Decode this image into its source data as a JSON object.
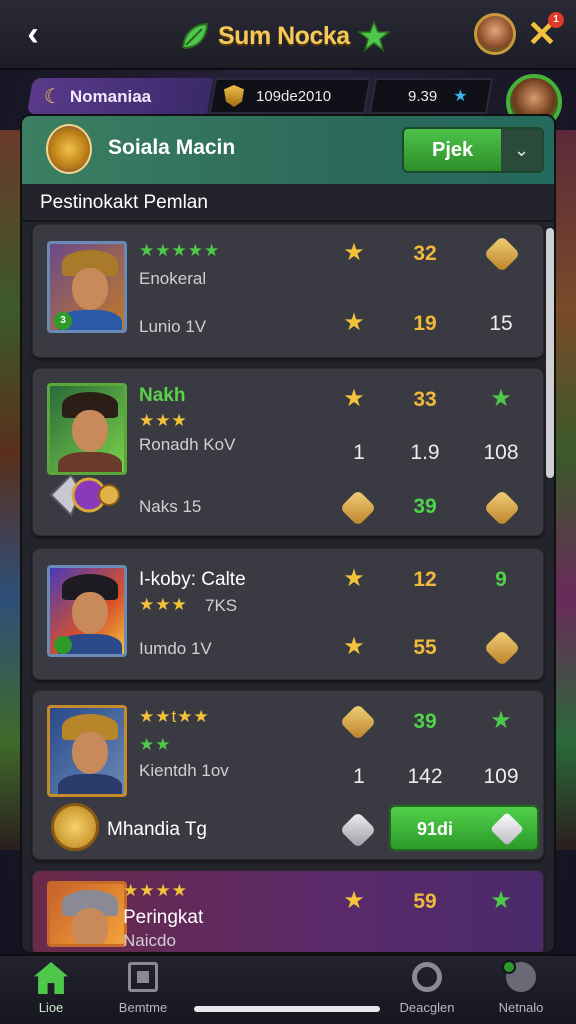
{
  "header": {
    "title": "Sum Nocka",
    "back_icon": "chevron-left-icon",
    "close_icon": "close-icon",
    "notification_count": "1"
  },
  "resources": {
    "player_name": "Nomaniaa",
    "code": "109de2010",
    "gems": "9.39"
  },
  "panel": {
    "title": "Soiala Macin",
    "dropdown_label": "Pjek",
    "section_label": "Pestinokakt Pemlan"
  },
  "cards": [
    {
      "stars": "★★★★★",
      "name": "Enokeral",
      "subtitle": "Lunio 1V",
      "portrait_level": "3",
      "stat_top": "32",
      "stat_bottom_a": "19",
      "stat_bottom_b": "15"
    },
    {
      "name": "Nakh",
      "stars": "★★★",
      "subtitle": "Ronadh KoV",
      "stat_top": "33",
      "row2_a": "1",
      "row2_b": "1.9",
      "row2_c": "108",
      "item_label": "Naks 15",
      "stat_bottom": "39"
    },
    {
      "name": "I-koby: Calte",
      "stars": "★★★",
      "stars_suffix": "7KS",
      "subtitle": "Iumdo 1V",
      "stat_top_a": "12",
      "stat_top_b": "9",
      "stat_bottom": "55"
    },
    {
      "stars": "★★t★★",
      "stars2": "★★",
      "subtitle": "Kientdh 1ov",
      "stat_top": "39",
      "row2_a": "1",
      "row2_b": "142",
      "row2_c": "109",
      "reward_label": "Mhandia Tg",
      "claim_label": "91di"
    },
    {
      "stars": "★★★★",
      "name": "Peringkat",
      "subtitle": "Naicdo",
      "stat_top": "59"
    }
  ],
  "bottom_nav": [
    {
      "label": "Lioe",
      "icon": "home-icon",
      "active": true
    },
    {
      "label": "Bemtme",
      "icon": "box-icon",
      "active": false
    },
    {
      "label": "Deacglen",
      "icon": "ring-icon",
      "active": false
    },
    {
      "label": "Netnalo",
      "icon": "tool-icon",
      "active": false
    }
  ],
  "colors": {
    "accent_green": "#4ec84a",
    "gold": "#f0b93a",
    "panel_bg": "#23232b"
  }
}
